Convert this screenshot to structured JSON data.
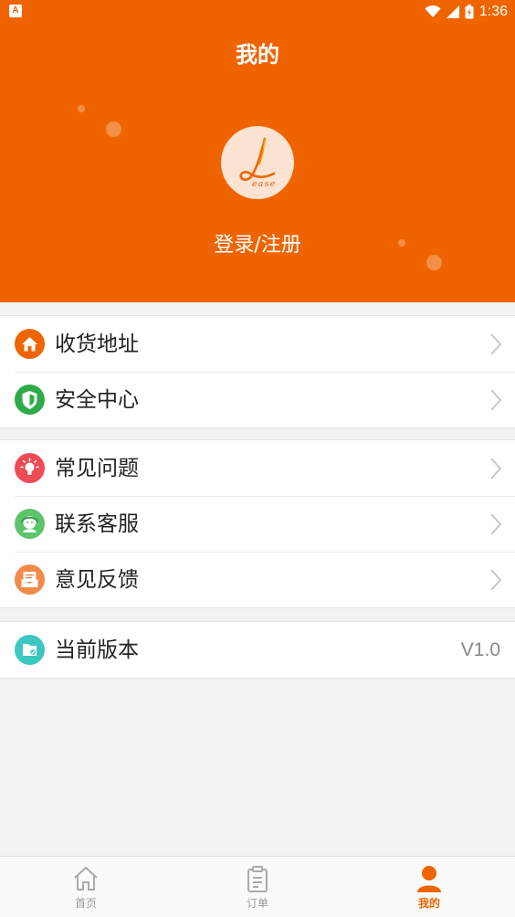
{
  "status_bar": {
    "time": "1:36",
    "notification_letter": "A"
  },
  "header": {
    "title": "我的",
    "login_label": "登录/注册"
  },
  "groups": [
    {
      "items": [
        {
          "label": "收货地址",
          "icon": "home-icon",
          "color": "#f06400"
        },
        {
          "label": "安全中心",
          "icon": "shield-icon",
          "color": "#2eaa4a"
        }
      ]
    },
    {
      "items": [
        {
          "label": "常见问题",
          "icon": "lightbulb-icon",
          "color": "#ee4b55"
        },
        {
          "label": "联系客服",
          "icon": "customer-service-icon",
          "color": "#5cc46a"
        },
        {
          "label": "意见反馈",
          "icon": "feedback-mail-icon",
          "color": "#f28a4a"
        }
      ]
    },
    {
      "items": [
        {
          "label": "当前版本",
          "icon": "version-icon",
          "color": "#3cc8c0",
          "value": "V1.0"
        }
      ]
    }
  ],
  "tabbar": {
    "tabs": [
      {
        "label": "首页",
        "icon": "home-outline-icon",
        "active": false
      },
      {
        "label": "订单",
        "icon": "clipboard-icon",
        "active": false
      },
      {
        "label": "我的",
        "icon": "person-icon",
        "active": true
      }
    ],
    "active_color": "#f06400"
  },
  "colors": {
    "brand": "#f06400",
    "background": "#f2f2f2"
  }
}
